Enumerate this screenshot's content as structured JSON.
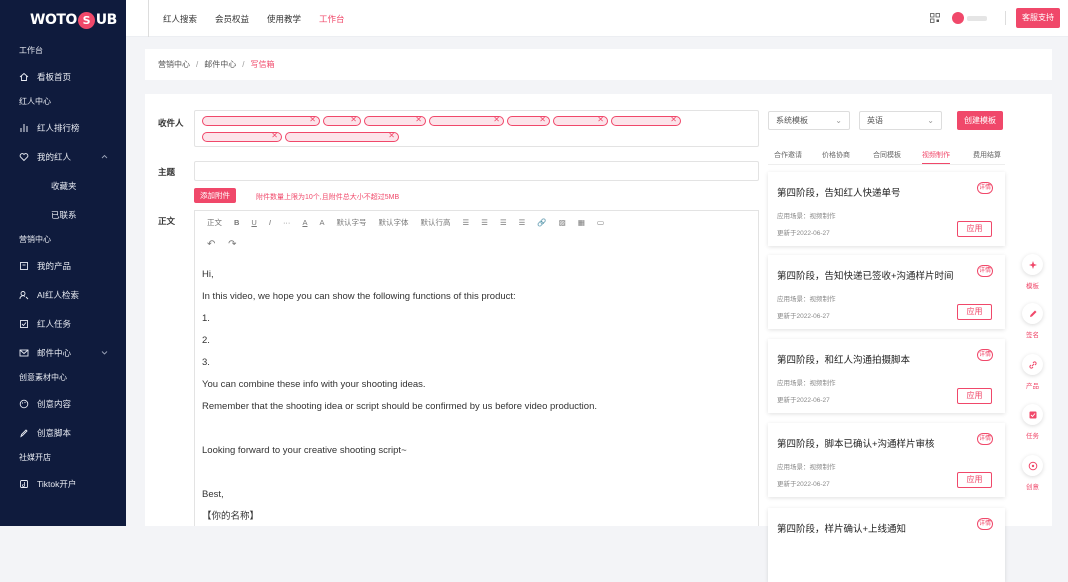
{
  "brand": {
    "logo_left": "WOTO",
    "logo_mid": "S",
    "logo_right": "UB"
  },
  "sidebar": {
    "section_workbench": "工作台",
    "item_dashboard": "看板首页",
    "section_influencer": "红人中心",
    "item_ranking": "红人排行榜",
    "item_my_influencers": "我的红人",
    "sub_favorites": "收藏夹",
    "sub_contacted": "已联系",
    "section_marketing": "营销中心",
    "item_products": "我的产品",
    "item_ai_search": "AI红人检索",
    "item_tasks": "红人任务",
    "item_mail": "邮件中心",
    "section_creative": "创意素材中心",
    "item_creative_content": "创意内容",
    "item_creative_script": "创意脚本",
    "section_shop": "社媒开店",
    "item_tiktok": "Tiktok开户"
  },
  "topnav": {
    "items": [
      "红人搜索",
      "会员权益",
      "使用教学",
      "工作台"
    ],
    "active_index": 3,
    "support_label": "客服支持"
  },
  "breadcrumb": {
    "level1": "营销中心",
    "level2": "邮件中心",
    "current": "写信箱",
    "sep": "/"
  },
  "compose": {
    "recipient_label": "收件人",
    "subject_label": "主题",
    "attach_button": "添加附件",
    "attach_tip": "附件数量上限为10个,且附件总大小不超过5MB",
    "body_label": "正文",
    "toolbar": [
      "正文",
      "B",
      "U",
      "I",
      "···",
      "A",
      "A",
      "默认字号",
      "默认字体",
      "默认行高",
      "☰",
      "☰",
      "☰",
      "☰",
      "🔗",
      "▨",
      "▦",
      "▭"
    ],
    "body_lines": [
      "Hi,",
      "In this video, we hope you can show the following functions of this product:",
      "1.",
      "2.",
      "3.",
      "You can combine these info with your shooting ideas.",
      "Remember that the shooting idea or script should be confirmed by us before video production.",
      "",
      "Looking forward to your creative shooting script~",
      "",
      "Best,",
      "【你的名称】"
    ]
  },
  "templates": {
    "select_type": "系统模板",
    "select_lang": "英语",
    "create_button": "创建模板",
    "tabs": [
      "合作邀请",
      "价格协商",
      "合同模板",
      "视频制作",
      "费用结算"
    ],
    "active_tab": 3,
    "detail_badge": "详情",
    "apply_label": "应用",
    "cards": [
      {
        "title": "第四阶段，告知红人快递单号",
        "scene": "应用场景：视频制作",
        "date": "更新于2022-06-27"
      },
      {
        "title": "第四阶段，告知快递已签收+沟通样片时间",
        "scene": "应用场景：视频制作",
        "date": "更新于2022-06-27"
      },
      {
        "title": "第四阶段，和红人沟通拍摄脚本",
        "scene": "应用场景：视频制作",
        "date": "更新于2022-06-27"
      },
      {
        "title": "第四阶段，脚本已确认+沟通样片审核",
        "scene": "应用场景：视频制作",
        "date": "更新于2022-06-27"
      },
      {
        "title": "第四阶段，样片确认+上线通知",
        "scene": "",
        "date": ""
      }
    ]
  },
  "float_tools": [
    "模板",
    "签名",
    "产品",
    "任务",
    "创意"
  ],
  "colors": {
    "accent": "#f0486a",
    "sidebar_bg": "#0f1b3d"
  }
}
